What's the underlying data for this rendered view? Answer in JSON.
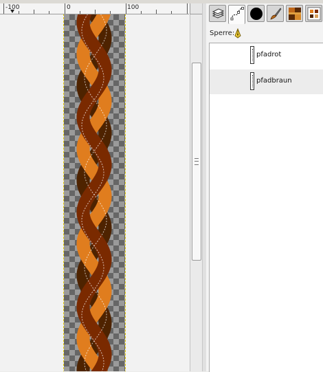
{
  "ruler": {
    "labels": [
      "-100",
      "0",
      "100"
    ]
  },
  "dock": {
    "tabs": [
      "layers-tab",
      "paths-tab",
      "brushes-tab",
      "tools-tab",
      "patterns-tab",
      "images-tab"
    ],
    "lock_label": "Sperre:",
    "paths": [
      {
        "name": "pfadrot",
        "selected": false
      },
      {
        "name": "pfadbraun",
        "selected": true
      }
    ]
  },
  "braid": {
    "colors": {
      "orange": "#e07d1e",
      "red_brown": "#7a2a00",
      "dark_brown": "#4e2300",
      "frame_dash": "#e8d000"
    }
  }
}
